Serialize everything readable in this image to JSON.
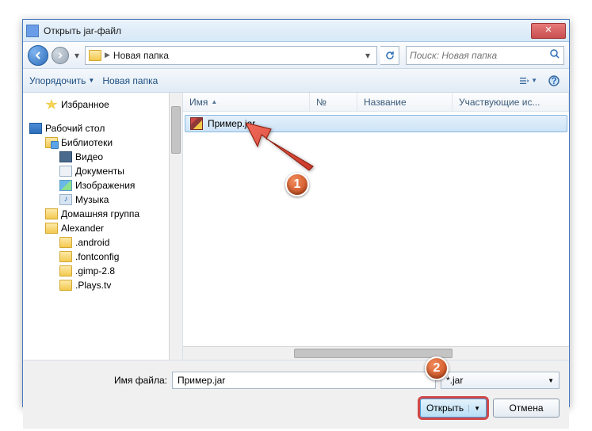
{
  "window": {
    "title": "Открыть jar-файл"
  },
  "nav": {
    "breadcrumb": "Новая папка",
    "search_placeholder": "Поиск: Новая папка"
  },
  "toolbar": {
    "organize": "Упорядочить",
    "newfolder": "Новая папка"
  },
  "sidebar": {
    "favorites": "Избранное",
    "desktop": "Рабочий стол",
    "libraries": "Библиотеки",
    "video": "Видео",
    "documents": "Документы",
    "pictures": "Изображения",
    "music": "Музыка",
    "homegroup": "Домашняя группа",
    "user": "Alexander",
    "f_android": ".android",
    "f_fontconfig": ".fontconfig",
    "f_gimp": ".gimp-2.8",
    "f_plays": ".Plays.tv"
  },
  "columns": {
    "name": "Имя",
    "num": "№",
    "title": "Название",
    "participants": "Участвующие ис..."
  },
  "files": {
    "selected": "Пример.jar"
  },
  "footer": {
    "filename_label": "Имя файла:",
    "filename_value": "Пример.jar",
    "filter": "*.jar",
    "open": "Открыть",
    "cancel": "Отмена"
  },
  "annotations": {
    "b1": "1",
    "b2": "2"
  }
}
